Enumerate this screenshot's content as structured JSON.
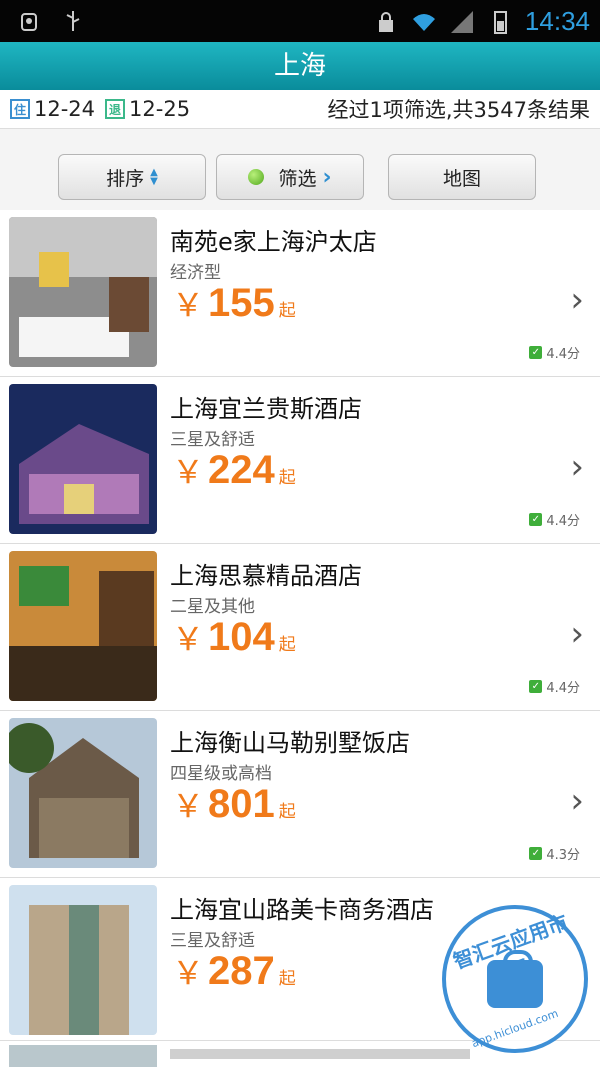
{
  "status_bar": {
    "time": "14:34"
  },
  "header": {
    "title": "上海"
  },
  "summary": {
    "checkin_icon": "住",
    "checkin_date": "12-24",
    "checkout_icon": "退",
    "checkout_date": "12-25",
    "result_text": "经过1项筛选,共3547条结果"
  },
  "toolbar": {
    "sort_label": "排序",
    "filter_label": "筛选",
    "map_label": "地图"
  },
  "hotels": [
    {
      "name": "南苑e家上海沪太店",
      "category": "经济型",
      "currency": "￥",
      "price": "155",
      "price_suffix": "起",
      "rating": "4.4分"
    },
    {
      "name": "上海宜兰贵斯酒店",
      "category": "三星及舒适",
      "currency": "￥",
      "price": "224",
      "price_suffix": "起",
      "rating": "4.4分"
    },
    {
      "name": "上海思慕精品酒店",
      "category": "二星及其他",
      "currency": "￥",
      "price": "104",
      "price_suffix": "起",
      "rating": "4.4分"
    },
    {
      "name": "上海衡山马勒别墅饭店",
      "category": "四星级或高档",
      "currency": "￥",
      "price": "801",
      "price_suffix": "起",
      "rating": "4.3分"
    },
    {
      "name": "上海宜山路美卡商务酒店",
      "category": "三星及舒适",
      "currency": "￥",
      "price": "287",
      "price_suffix": "起",
      "rating": ""
    }
  ],
  "watermark": {
    "title": "智汇云应用市场",
    "url": "app.hicloud.com"
  },
  "colors": {
    "accent": "#1aa8b8",
    "price": "#f07a1a",
    "rating_check": "#3fae3a"
  }
}
